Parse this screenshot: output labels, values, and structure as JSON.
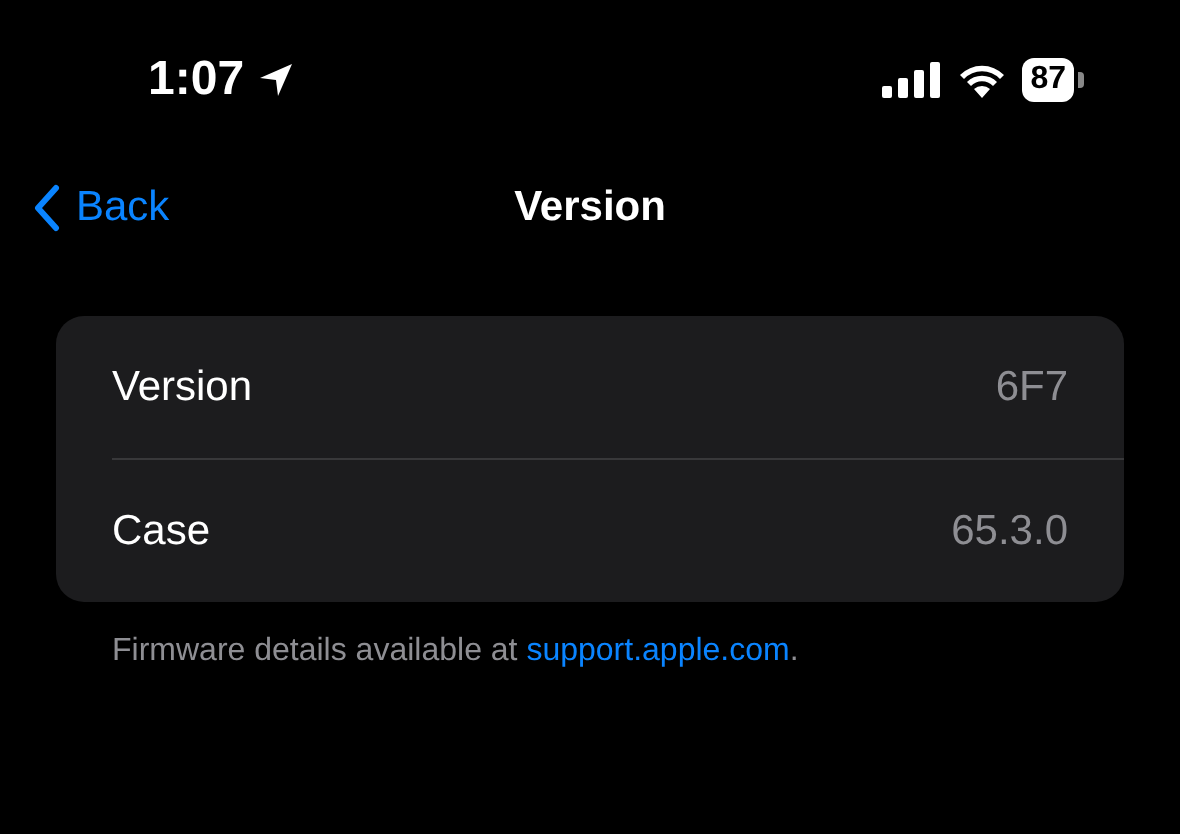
{
  "status_bar": {
    "time": "1:07",
    "battery": "87"
  },
  "nav": {
    "back": "Back",
    "title": "Version"
  },
  "rows": [
    {
      "label": "Version",
      "value": "6F7"
    },
    {
      "label": "Case",
      "value": "65.3.0"
    }
  ],
  "footer": {
    "text": "Firmware details available at ",
    "link": "support.apple.com",
    "end": "."
  }
}
